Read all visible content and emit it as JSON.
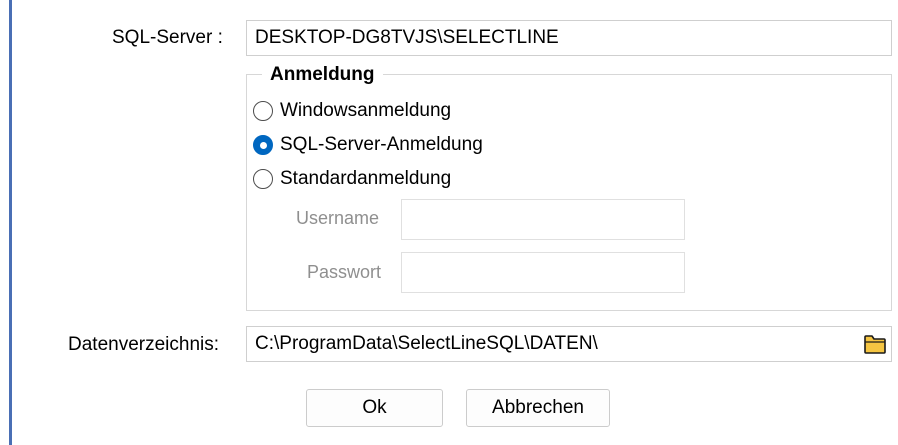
{
  "server": {
    "label": "SQL-Server :",
    "value": "DESKTOP-DG8TVJS\\SELECTLINE"
  },
  "login": {
    "title": "Anmeldung",
    "options": [
      "Windowsanmeldung",
      "SQL-Server-Anmeldung",
      "Standardanmeldung"
    ],
    "selected": "SQL-Server-Anmeldung",
    "username_label": "Username",
    "username_value": "",
    "password_label": "Passwort",
    "password_value": ""
  },
  "data_dir": {
    "label": "Datenverzeichnis:",
    "value": "C:\\ProgramData\\SelectLineSQL\\DATEN\\",
    "browse_icon": "folder-icon"
  },
  "buttons": {
    "ok": "Ok",
    "cancel": "Abbrechen"
  },
  "colors": {
    "accent": "#0067c0",
    "folder": "#f5c542"
  }
}
